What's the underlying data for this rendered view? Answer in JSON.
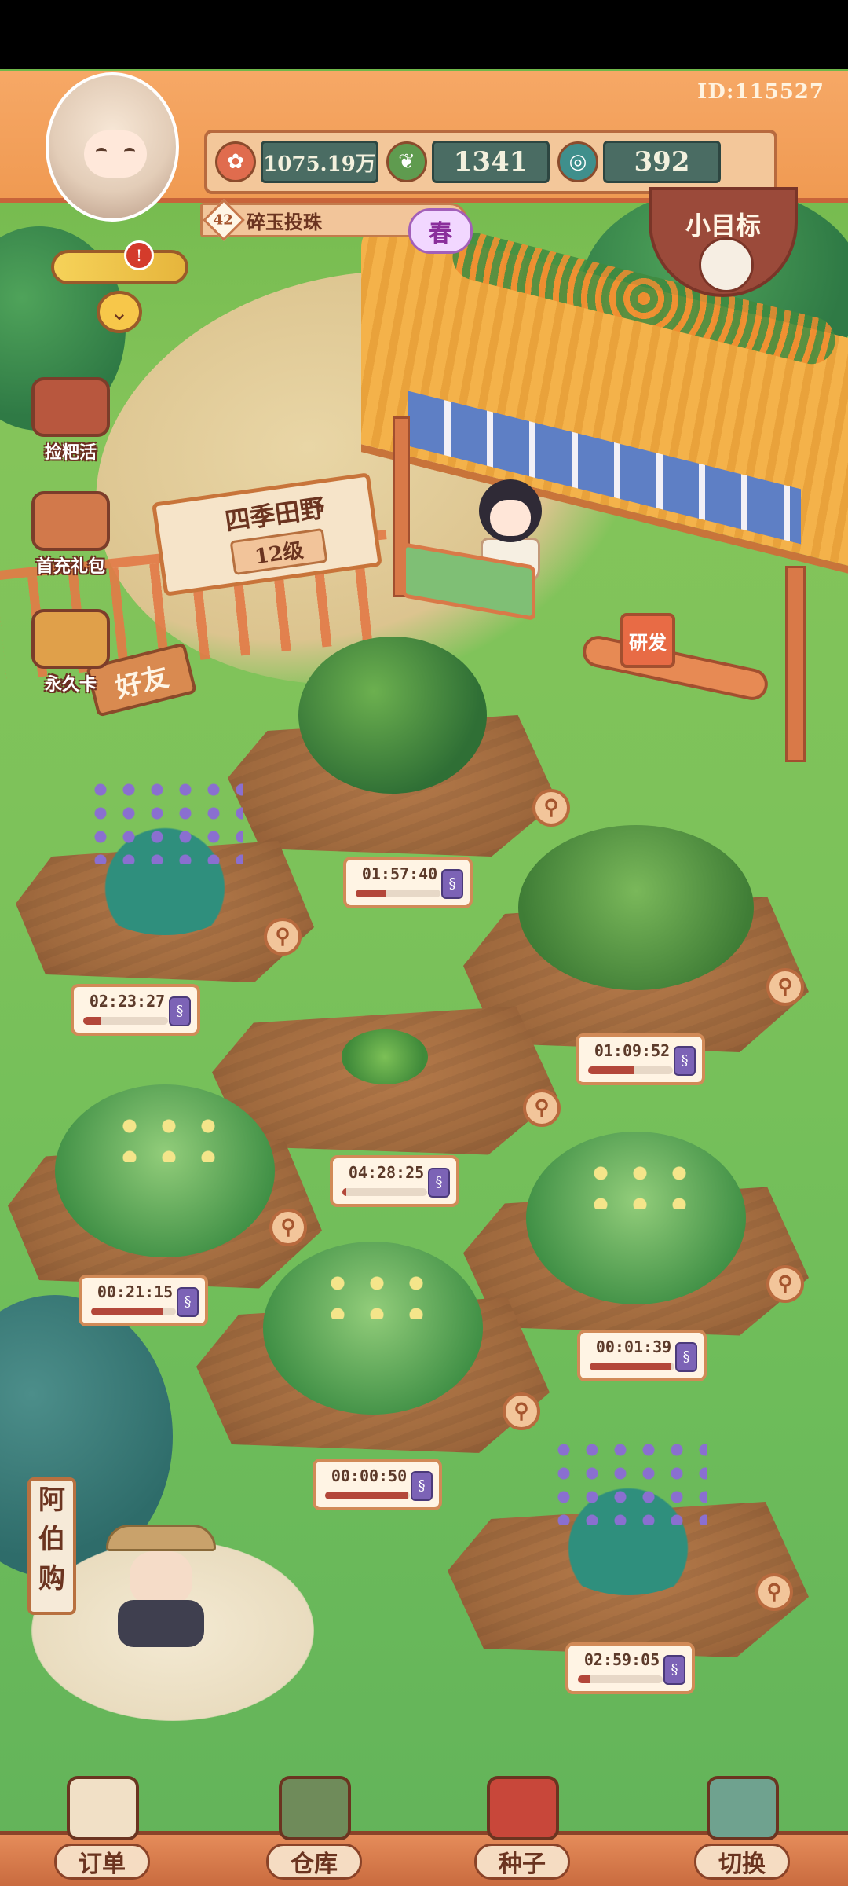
{
  "player": {
    "id_label": "ID:115527"
  },
  "resources": {
    "coins": "1075.19万",
    "leaves": "1341",
    "gems": "392"
  },
  "level": {
    "number": "42",
    "title": "碎玉投珠"
  },
  "season": "春",
  "goal": {
    "label": "小目标"
  },
  "side_menu": [
    {
      "label": "捡粑活"
    },
    {
      "label": "首充礼包"
    },
    {
      "label": "永久卡"
    }
  ],
  "farm": {
    "name": "四季田野",
    "level": "12级"
  },
  "friend_sign": "好友",
  "research_label": "研发",
  "plots": [
    {
      "crop": "tree",
      "timer": "01:57:40",
      "progress": 0.35
    },
    {
      "crop": "lavender",
      "timer": "02:23:27",
      "progress": 0.2
    },
    {
      "crop": "bush",
      "timer": "01:09:52",
      "progress": 0.55
    },
    {
      "crop": "sprout",
      "timer": "04:28:25",
      "progress": 0.05
    },
    {
      "crop": "flower",
      "timer": "00:21:15",
      "progress": 0.85
    },
    {
      "crop": "flower",
      "timer": "00:01:39",
      "progress": 0.95
    },
    {
      "crop": "flower",
      "timer": "00:00:50",
      "progress": 0.97
    },
    {
      "crop": "lavender",
      "timer": "02:59:05",
      "progress": 0.15
    }
  ],
  "shop": {
    "banner": [
      "阿",
      "伯",
      "购"
    ]
  },
  "bottom_nav": [
    {
      "label": "订单",
      "icon": "clipboard-icon"
    },
    {
      "label": "仓库",
      "icon": "warehouse-icon"
    },
    {
      "label": "种子",
      "icon": "seed-book-icon"
    },
    {
      "label": "切换",
      "icon": "map-icon"
    }
  ],
  "colors": {
    "timer_fill": "#b3473a",
    "speedup": "#7c63b6",
    "topbar": "#f09a52"
  }
}
